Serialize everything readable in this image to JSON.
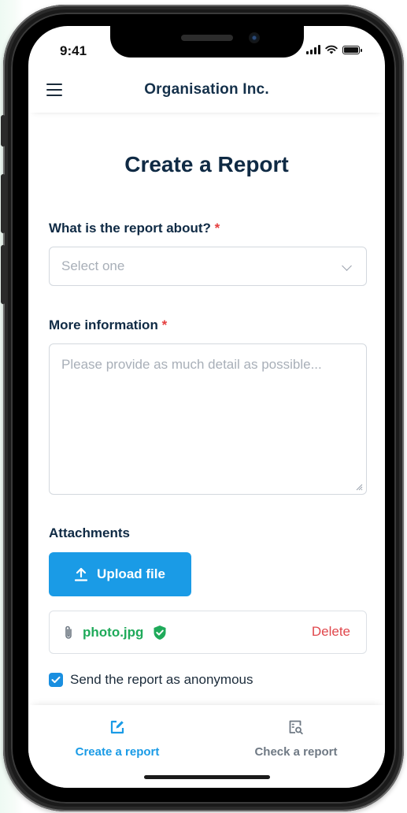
{
  "status_bar": {
    "time": "9:41"
  },
  "header": {
    "title": "Organisation Inc."
  },
  "page": {
    "title": "Create a Report"
  },
  "form": {
    "topic": {
      "label": "What is the report about?",
      "required_mark": "*",
      "placeholder": "Select one"
    },
    "details": {
      "label": "More information",
      "required_mark": "*",
      "placeholder": "Please provide as much detail as possible..."
    },
    "attachments": {
      "label": "Attachments",
      "upload_label": "Upload file",
      "files": [
        {
          "name": "photo.jpg",
          "delete_label": "Delete"
        }
      ]
    },
    "anonymous": {
      "label": "Send the report as anonymous",
      "checked": true
    }
  },
  "bottom_nav": {
    "items": [
      {
        "label": "Create a report",
        "icon": "edit-icon",
        "active": true
      },
      {
        "label": "Check a report",
        "icon": "report-search-icon",
        "active": false
      }
    ]
  },
  "colors": {
    "primary": "#1a9be6",
    "heading": "#0f2a44",
    "success": "#1faa5a",
    "danger": "#e0474c",
    "required": "#e53e3e",
    "inactive_nav": "#6f7984"
  }
}
